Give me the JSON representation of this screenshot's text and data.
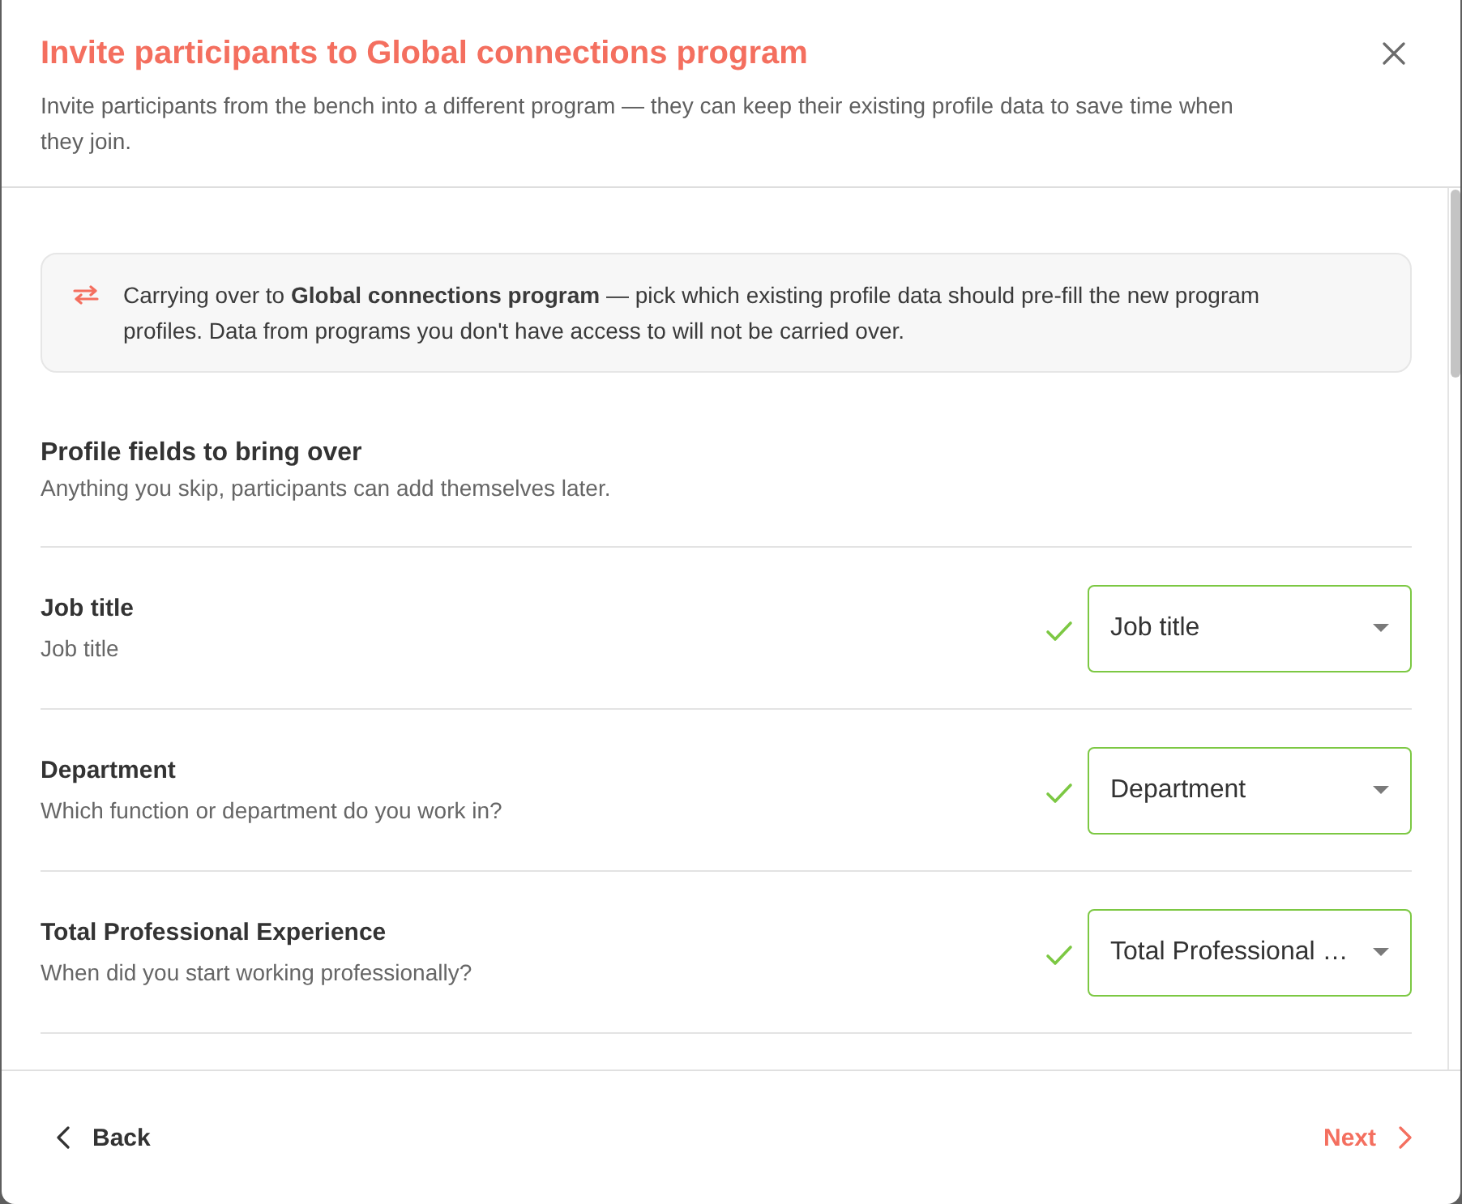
{
  "dialog": {
    "title": "Invite participants to Global connections program",
    "subtitle": "Invite participants from the bench into a different program — they can keep their existing profile data to save time when they join."
  },
  "notice": {
    "text": "Carrying over to **Global connections program** — pick which existing profile data should pre-fill the new program profiles. Data from programs you don't have access to will not be carried over."
  },
  "section": {
    "title": "Profile fields to bring over",
    "subtitle": "Anything you skip, participants can add themselves later."
  },
  "fields": [
    {
      "label": "Job title",
      "description": "Job title",
      "value": "Job title",
      "matched": true
    },
    {
      "label": "Department",
      "description": "Which function or department do you work in?",
      "value": "Department",
      "matched": true
    },
    {
      "label": "Total Professional Experience",
      "description": "When did you start working professionally?",
      "value": "Total Professional …",
      "matched": true
    }
  ],
  "footer": {
    "back": "Back",
    "next": "Next"
  }
}
